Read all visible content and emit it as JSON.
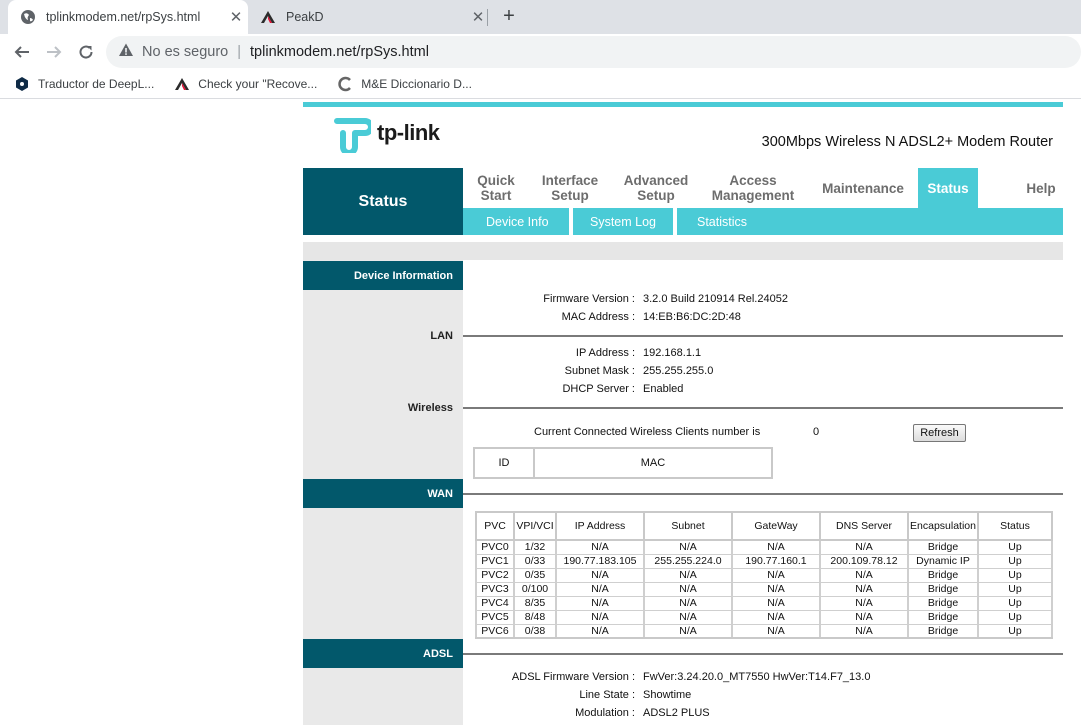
{
  "browser": {
    "tabs": [
      {
        "title": "tplinkmodem.net/rpSys.html",
        "active": true
      },
      {
        "title": "PeakD",
        "active": false
      }
    ],
    "new_tab_label": "+",
    "close_label": "✕",
    "address": {
      "security_text": "No es seguro",
      "url": "tplinkmodem.net/rpSys.html"
    },
    "bookmarks": [
      {
        "label": "Traductor de DeepL...",
        "icon": "deepl-icon"
      },
      {
        "label": "Check your \"Recove...",
        "icon": "peakd-icon"
      },
      {
        "label": "M&E Diccionario D...",
        "icon": "me-dictionary-icon"
      }
    ]
  },
  "router": {
    "brand": "tp-link",
    "model": "300Mbps Wireless N ADSL2+ Modem Router",
    "nav_status_title": "Status",
    "menu": [
      {
        "label": "Quick\nStart",
        "active": false
      },
      {
        "label": "Interface\nSetup",
        "active": false
      },
      {
        "label": "Advanced\nSetup",
        "active": false
      },
      {
        "label": "Access\nManagement",
        "active": false
      },
      {
        "label": "Maintenance",
        "active": false
      },
      {
        "label": "Status",
        "active": true
      },
      {
        "label": "Help",
        "active": false
      }
    ],
    "submenu": [
      "Device Info",
      "System Log",
      "Statistics"
    ],
    "sections": {
      "device_information": "Device Information",
      "lan": "LAN",
      "wireless": "Wireless",
      "wan": "WAN",
      "adsl": "ADSL"
    },
    "device": {
      "firmware_label": "Firmware Version :",
      "firmware_value": "3.2.0 Build 210914 Rel.24052",
      "mac_label": "MAC Address :",
      "mac_value": "14:EB:B6:DC:2D:48"
    },
    "lan": {
      "ip_label": "IP Address :",
      "ip_value": "192.168.1.1",
      "mask_label": "Subnet Mask :",
      "mask_value": "255.255.255.0",
      "dhcp_label": "DHCP Server :",
      "dhcp_value": "Enabled"
    },
    "wireless": {
      "clients_label": "Current Connected Wireless Clients number is",
      "clients_value": "0",
      "refresh_label": "Refresh",
      "table_headers": [
        "ID",
        "MAC"
      ]
    },
    "wan": {
      "headers": [
        "PVC",
        "VPI/VCI",
        "IP Address",
        "Subnet",
        "GateWay",
        "DNS Server",
        "Encapsulation",
        "Status"
      ],
      "rows": [
        [
          "PVC0",
          "1/32",
          "N/A",
          "N/A",
          "N/A",
          "N/A",
          "Bridge",
          "Up"
        ],
        [
          "PVC1",
          "0/33",
          "190.77.183.105",
          "255.255.224.0",
          "190.77.160.1",
          "200.109.78.12",
          "Dynamic IP",
          "Up"
        ],
        [
          "PVC2",
          "0/35",
          "N/A",
          "N/A",
          "N/A",
          "N/A",
          "Bridge",
          "Up"
        ],
        [
          "PVC3",
          "0/100",
          "N/A",
          "N/A",
          "N/A",
          "N/A",
          "Bridge",
          "Up"
        ],
        [
          "PVC4",
          "8/35",
          "N/A",
          "N/A",
          "N/A",
          "N/A",
          "Bridge",
          "Up"
        ],
        [
          "PVC5",
          "8/48",
          "N/A",
          "N/A",
          "N/A",
          "N/A",
          "Bridge",
          "Up"
        ],
        [
          "PVC6",
          "0/38",
          "N/A",
          "N/A",
          "N/A",
          "N/A",
          "Bridge",
          "Up"
        ]
      ]
    },
    "adsl": {
      "fw_label": "ADSL Firmware Version :",
      "fw_value": "FwVer:3.24.20.0_MT7550 HwVer:T14.F7_13.0",
      "line_label": "Line State :",
      "line_value": "Showtime",
      "mod_label": "Modulation :",
      "mod_value": "ADSL2 PLUS"
    },
    "colors": {
      "accent": "#4acbd6",
      "dark_teal": "#02586b"
    }
  }
}
